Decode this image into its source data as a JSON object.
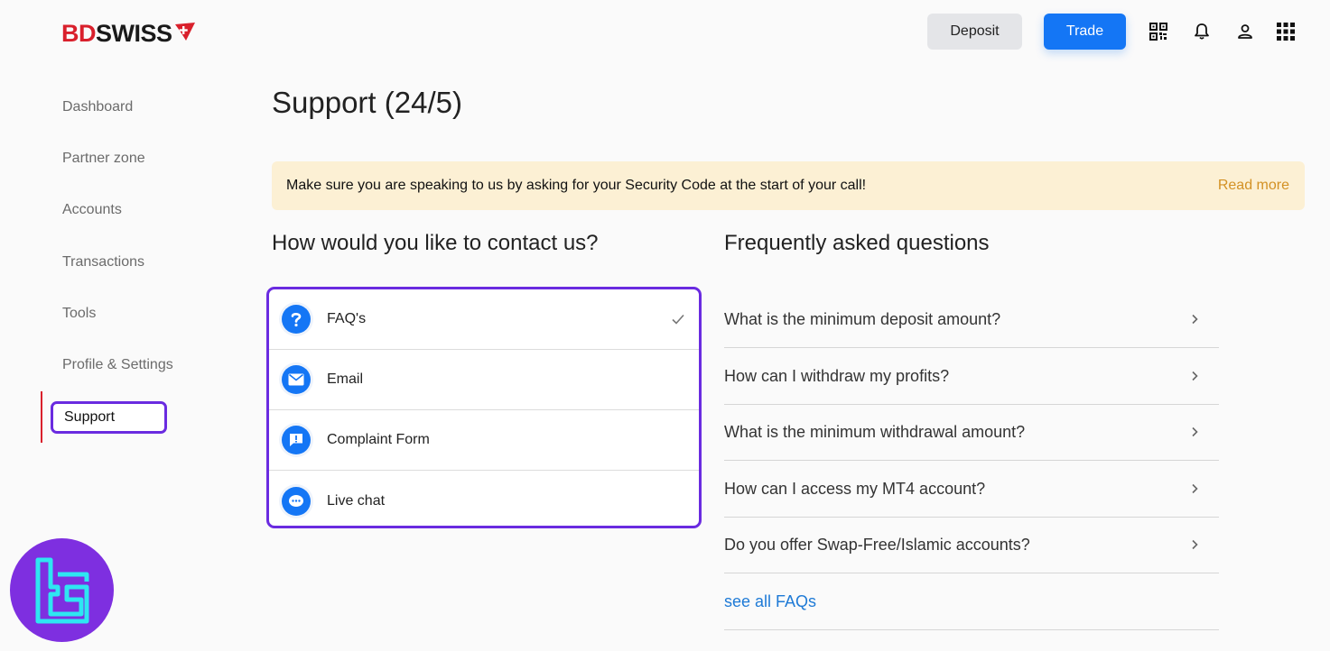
{
  "brand": {
    "name_part1": "BD",
    "name_part2": "SWISS",
    "brand_red": "#d9202c"
  },
  "header": {
    "deposit_label": "Deposit",
    "trade_label": "Trade",
    "icons": [
      "qr-code-icon",
      "bell-icon",
      "user-icon",
      "apps-grid-icon"
    ],
    "accent": "#1476f5"
  },
  "sidebar": {
    "items": [
      {
        "label": "Dashboard"
      },
      {
        "label": "Partner zone"
      },
      {
        "label": "Accounts"
      },
      {
        "label": "Transactions"
      },
      {
        "label": "Tools"
      },
      {
        "label": "Profile & Settings"
      },
      {
        "label": "Support",
        "active": true
      }
    ]
  },
  "main": {
    "title": "Support (24/5)",
    "notice": {
      "text": "Make sure you are speaking to us by asking for your Security Code at the start of your call!",
      "link": "Read more"
    },
    "contact": {
      "title": "How would you like to contact us?",
      "options": [
        {
          "label": "FAQ's",
          "icon": "question-icon",
          "selected": true
        },
        {
          "label": "Email",
          "icon": "email-icon"
        },
        {
          "label": "Complaint Form",
          "icon": "complaint-icon"
        },
        {
          "label": "Live chat",
          "icon": "chat-icon"
        }
      ]
    },
    "faq": {
      "title": "Frequently asked questions",
      "questions": [
        "What is the minimum deposit amount?",
        "How can I withdraw my profits?",
        "What is the minimum withdrawal amount?",
        "How can I access my MT4 account?",
        "Do you offer Swap-Free/Islamic accounts?"
      ],
      "see_all": "see all FAQs"
    }
  },
  "highlight_color": "#6a2be0"
}
